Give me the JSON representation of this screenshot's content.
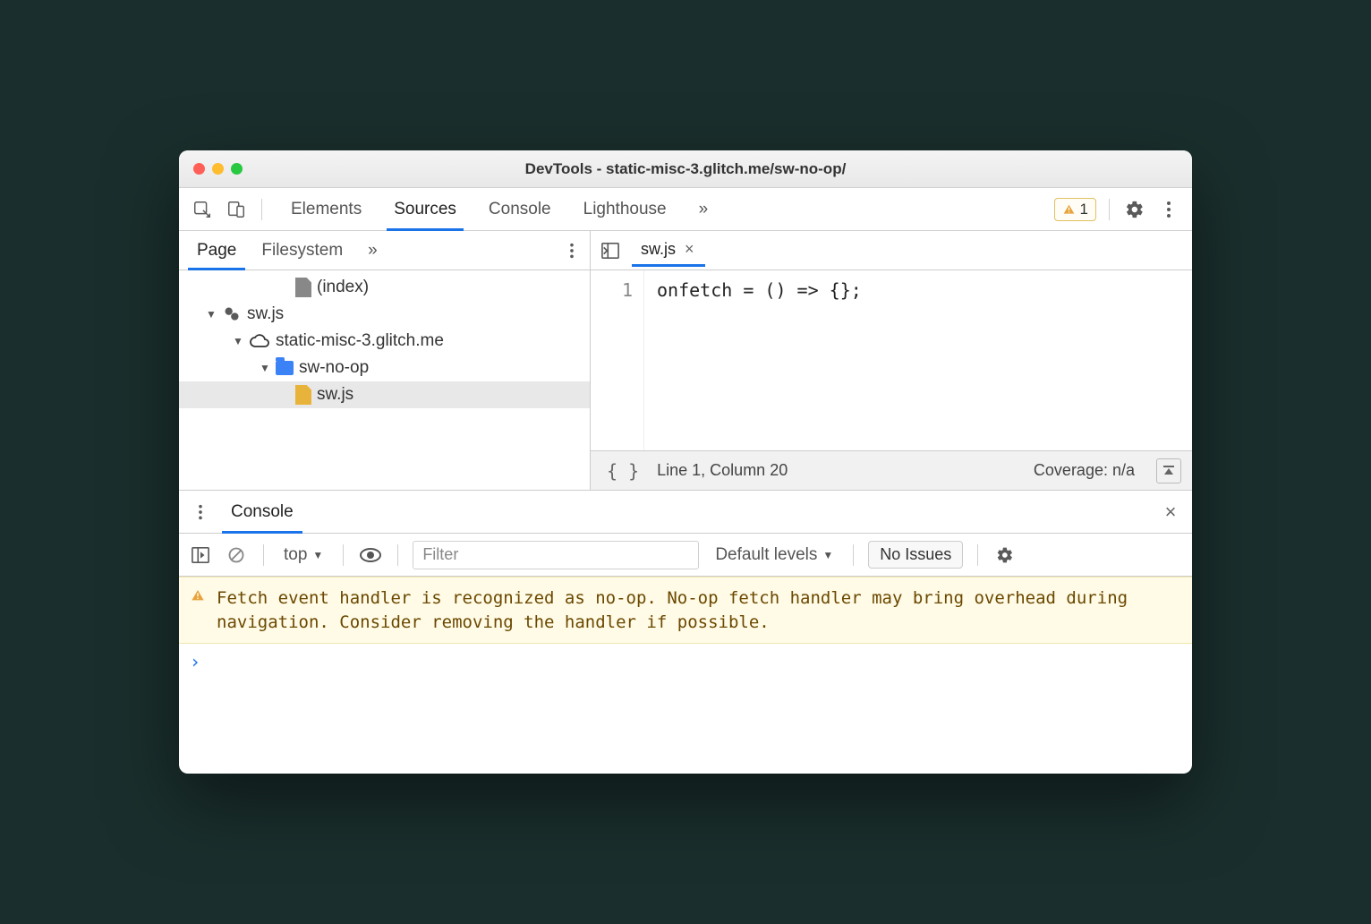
{
  "window": {
    "title": "DevTools - static-misc-3.glitch.me/sw-no-op/"
  },
  "mainTabs": {
    "items": [
      "Elements",
      "Sources",
      "Console",
      "Lighthouse"
    ],
    "activeIndex": 1,
    "overflowVisible": true
  },
  "warningBadge": {
    "count": "1"
  },
  "sourcesSidebar": {
    "tabs": [
      "Page",
      "Filesystem"
    ],
    "activeIndex": 0,
    "tree": {
      "indexLabel": "(index)",
      "swRoot": "sw.js",
      "origin": "static-misc-3.glitch.me",
      "folder": "sw-no-op",
      "file": "sw.js"
    }
  },
  "editor": {
    "tabLabel": "sw.js",
    "lineNumbers": [
      "1"
    ],
    "code": "onfetch = () => {};",
    "statusPos": "Line 1, Column 20",
    "coverage": "Coverage: n/a"
  },
  "drawer": {
    "tab": "Console"
  },
  "consoleToolbar": {
    "context": "top",
    "filterPlaceholder": "Filter",
    "levels": "Default levels",
    "issues": "No Issues"
  },
  "consoleWarning": "Fetch event handler is recognized as no-op. No-op fetch handler may bring overhead during navigation. Consider removing the handler if possible.",
  "prompt": "›"
}
